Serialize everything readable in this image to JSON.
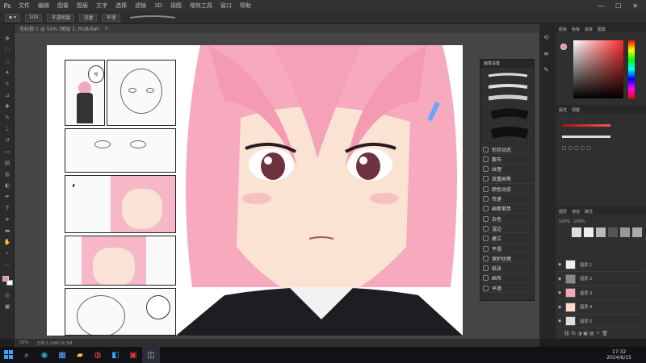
{
  "menubar": {
    "logo": "Ps",
    "items": [
      "文件",
      "编辑",
      "图像",
      "图层",
      "文字",
      "选择",
      "滤镜",
      "3D",
      "视图",
      "增效工具",
      "窗口",
      "帮助"
    ],
    "window_controls": [
      "—",
      "☐",
      "✕"
    ]
  },
  "optionsbar": {
    "items": [
      "100",
      "不透明度",
      "流量",
      "平滑"
    ]
  },
  "document_tab": {
    "label": "无标题-1 @ 50% (图层 1, RGB/8#)"
  },
  "statusbar": {
    "zoom": "50%",
    "info": "文档:3.20M/16.5M"
  },
  "brush_panel": {
    "title": "画笔设置",
    "options": [
      "形状动态",
      "散布",
      "纹理",
      "双重画笔",
      "颜色动态",
      "传递",
      "画笔笔势",
      "杂色",
      "湿边",
      "建立",
      "平滑",
      "保护纹理",
      "纸张",
      "画布",
      "平滑"
    ]
  },
  "right_panel": {
    "tabs_top": [
      "颜色",
      "色板",
      "渐变",
      "图案"
    ],
    "tabs_mid": [
      "属性",
      "调整"
    ],
    "tabs_layers": [
      "图层",
      "通道",
      "路径"
    ],
    "layers": [
      "图层 1",
      "图层 2",
      "图层 3",
      "图层 4",
      "图层 5"
    ],
    "layer_opacity": "100%",
    "layer_fill": "100%"
  },
  "taskbar": {
    "icons": [
      "windows-start-icon",
      "search-icon",
      "edge-icon",
      "explorer-icon",
      "files-icon",
      "chrome-icon",
      "app-icon",
      "photoshop-icon",
      "capture-icon"
    ],
    "time": "17:32",
    "date": "2024/6/15"
  },
  "speech_bubble": {
    "text": "哎"
  }
}
